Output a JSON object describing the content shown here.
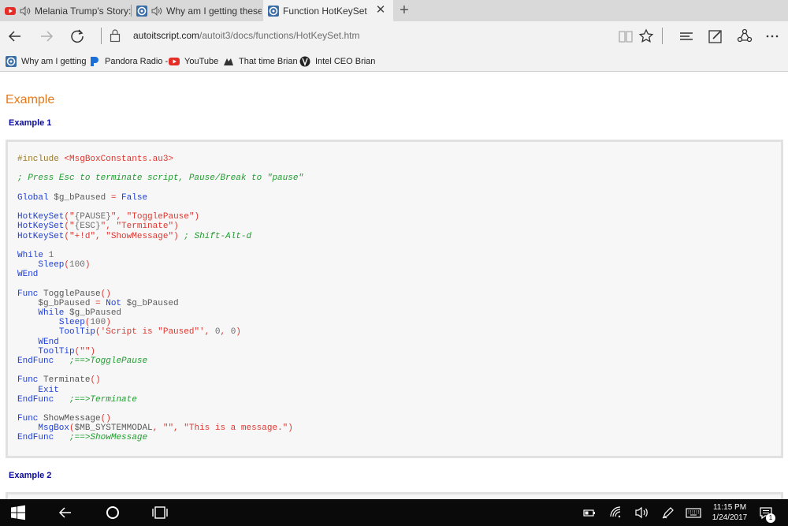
{
  "tabs": [
    {
      "title": "Melania Trump's Story:",
      "favicon": "youtube-icon",
      "audio": true,
      "active": false
    },
    {
      "title": "Why am I getting these",
      "favicon": "autoit-icon",
      "audio": true,
      "active": false
    },
    {
      "title": "Function HotKeySet",
      "favicon": "autoit-icon",
      "audio": false,
      "active": true
    }
  ],
  "new_tab_label": "+",
  "close_label": "✕",
  "address": {
    "host": "autoitscript.com",
    "path": "/autoit3/docs/functions/HotKeySet.htm"
  },
  "favorites": [
    {
      "label": "Why am I getting",
      "icon": "autoit-icon"
    },
    {
      "label": "Pandora Radio -",
      "icon": "pandora-icon"
    },
    {
      "label": "YouTube",
      "icon": "youtube-icon"
    },
    {
      "label": "That time Brian",
      "icon": "gif-icon"
    },
    {
      "label": "Intel CEO Brian",
      "icon": "verge-icon"
    }
  ],
  "page": {
    "section_title": "Example",
    "example1_heading": "Example 1",
    "example2_heading": "Example 2",
    "example1_code": [
      [
        [
          "pre",
          "#include "
        ],
        [
          "inc",
          "<MsgBoxConstants.au3>"
        ]
      ],
      [],
      [
        [
          "cmt",
          "; Press Esc to terminate script, Pause/Break to \"pause\""
        ]
      ],
      [],
      [
        [
          "kw",
          "Global "
        ],
        [
          "var",
          "$g_bPaused "
        ],
        [
          "op",
          "= "
        ],
        [
          "kw",
          "False"
        ]
      ],
      [],
      [
        [
          "fn",
          "HotKeySet"
        ],
        [
          "op",
          "(\""
        ],
        [
          "num",
          "{PAUSE}"
        ],
        [
          "op",
          "\", "
        ],
        [
          "str",
          "\"TogglePause\""
        ],
        [
          "op",
          ")"
        ]
      ],
      [
        [
          "fn",
          "HotKeySet"
        ],
        [
          "op",
          "(\""
        ],
        [
          "num",
          "{ESC}"
        ],
        [
          "op",
          "\", "
        ],
        [
          "str",
          "\"Terminate\""
        ],
        [
          "op",
          ")"
        ]
      ],
      [
        [
          "fn",
          "HotKeySet"
        ],
        [
          "op",
          "(\""
        ],
        [
          "str",
          "+!d"
        ],
        [
          "op",
          "\", "
        ],
        [
          "str",
          "\"ShowMessage\""
        ],
        [
          "op",
          ") "
        ],
        [
          "cmt",
          "; Shift-Alt-d"
        ]
      ],
      [],
      [
        [
          "kw",
          "While "
        ],
        [
          "num",
          "1"
        ]
      ],
      [
        [
          "plain",
          "    "
        ],
        [
          "fn",
          "Sleep"
        ],
        [
          "op",
          "("
        ],
        [
          "num",
          "100"
        ],
        [
          "op",
          ")"
        ]
      ],
      [
        [
          "kw",
          "WEnd"
        ]
      ],
      [],
      [
        [
          "kw",
          "Func "
        ],
        [
          "plain",
          "TogglePause"
        ],
        [
          "op",
          "()"
        ]
      ],
      [
        [
          "plain",
          "    "
        ],
        [
          "var",
          "$g_bPaused "
        ],
        [
          "op",
          "= "
        ],
        [
          "kw",
          "Not "
        ],
        [
          "var",
          "$g_bPaused"
        ]
      ],
      [
        [
          "plain",
          "    "
        ],
        [
          "kw",
          "While "
        ],
        [
          "var",
          "$g_bPaused"
        ]
      ],
      [
        [
          "plain",
          "        "
        ],
        [
          "fn",
          "Sleep"
        ],
        [
          "op",
          "("
        ],
        [
          "num",
          "100"
        ],
        [
          "op",
          ")"
        ]
      ],
      [
        [
          "plain",
          "        "
        ],
        [
          "fn",
          "ToolTip"
        ],
        [
          "op",
          "("
        ],
        [
          "str",
          "'Script is \"Paused\"'"
        ],
        [
          "op",
          ", "
        ],
        [
          "num",
          "0"
        ],
        [
          "op",
          ", "
        ],
        [
          "num",
          "0"
        ],
        [
          "op",
          ")"
        ]
      ],
      [
        [
          "plain",
          "    "
        ],
        [
          "kw",
          "WEnd"
        ]
      ],
      [
        [
          "plain",
          "    "
        ],
        [
          "fn",
          "ToolTip"
        ],
        [
          "op",
          "(\"\")"
        ]
      ],
      [
        [
          "kw",
          "EndFunc"
        ],
        [
          "plain",
          "   "
        ],
        [
          "cmt",
          ";==>TogglePause"
        ]
      ],
      [],
      [
        [
          "kw",
          "Func "
        ],
        [
          "plain",
          "Terminate"
        ],
        [
          "op",
          "()"
        ]
      ],
      [
        [
          "plain",
          "    "
        ],
        [
          "kw",
          "Exit"
        ]
      ],
      [
        [
          "kw",
          "EndFunc"
        ],
        [
          "plain",
          "   "
        ],
        [
          "cmt",
          ";==>Terminate"
        ]
      ],
      [],
      [
        [
          "kw",
          "Func "
        ],
        [
          "plain",
          "ShowMessage"
        ],
        [
          "op",
          "()"
        ]
      ],
      [
        [
          "plain",
          "    "
        ],
        [
          "fn",
          "MsgBox"
        ],
        [
          "op",
          "("
        ],
        [
          "var",
          "$MB_SYSTEMMODAL"
        ],
        [
          "op",
          ", \"\", "
        ],
        [
          "str",
          "\"This is a message.\""
        ],
        [
          "op",
          ")"
        ]
      ],
      [
        [
          "kw",
          "EndFunc"
        ],
        [
          "plain",
          "   "
        ],
        [
          "cmt",
          ";==>ShowMessage"
        ]
      ]
    ]
  },
  "taskbar": {
    "time": "11:15 PM",
    "date": "1/24/2017",
    "notification_count": "1"
  }
}
